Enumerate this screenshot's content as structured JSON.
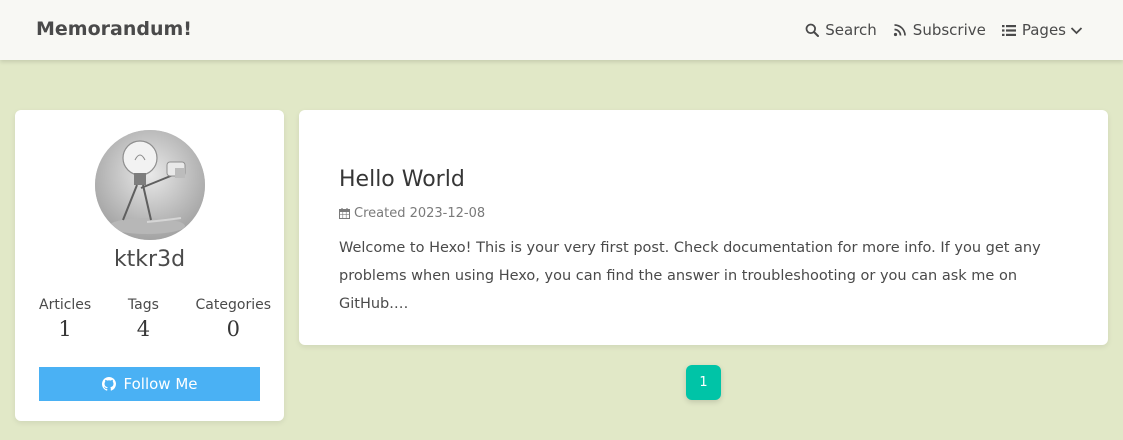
{
  "navbar": {
    "brand": "Memorandum!",
    "items": [
      {
        "label": "Search",
        "icon": "search-icon"
      },
      {
        "label": "Subscrive",
        "icon": "rss-icon"
      },
      {
        "label": "Pages",
        "icon": "list-icon"
      }
    ]
  },
  "profile": {
    "username": "ktkr3d",
    "stats": [
      {
        "label": "Articles",
        "value": "1"
      },
      {
        "label": "Tags",
        "value": "4"
      },
      {
        "label": "Categories",
        "value": "0"
      }
    ],
    "follow_label": "Follow Me",
    "follow_icon": "github-icon"
  },
  "post": {
    "title": "Hello World",
    "meta": "Created 2023-12-08",
    "excerpt": "Welcome to Hexo! This is your very first post. Check documentation for more info. If you get any problems when using Hexo, you can find the answer in troubleshooting or you can ask me on GitHub.…"
  },
  "pagination": {
    "current": "1"
  },
  "colors": {
    "background": "#e1e8c7",
    "navbar": "#f8f8f4",
    "follow_button": "#4ab1f4",
    "pagination_active": "#00c4a7"
  }
}
